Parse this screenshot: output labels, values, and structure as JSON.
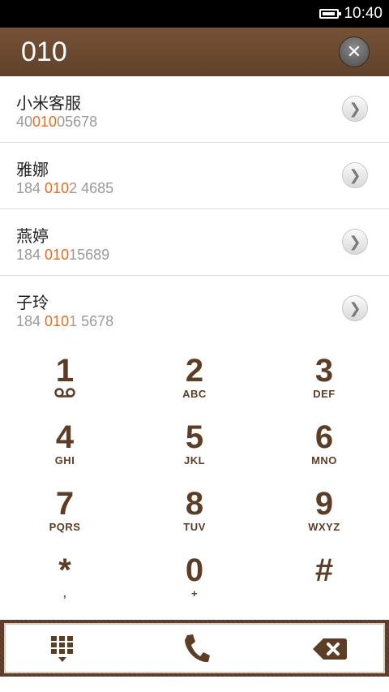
{
  "status_bar": {
    "time": "10:40",
    "battery_level": 0.9
  },
  "search": {
    "query": "010",
    "clear_icon": "close-icon"
  },
  "results": [
    {
      "name": "小米客服",
      "number_parts": [
        "40",
        "010",
        "05678"
      ]
    },
    {
      "name": "雅娜",
      "number_parts": [
        "184 ",
        "010",
        "2 4685"
      ]
    },
    {
      "name": "燕婷",
      "number_parts": [
        "184 ",
        "010",
        "15689"
      ]
    },
    {
      "name": "子玲",
      "number_parts": [
        "184 ",
        "010",
        "1 5678"
      ]
    }
  ],
  "keypad": [
    {
      "digit": "1",
      "letters": "",
      "sub_icon": "voicemail-icon"
    },
    {
      "digit": "2",
      "letters": "ABC"
    },
    {
      "digit": "3",
      "letters": "DEF"
    },
    {
      "digit": "4",
      "letters": "GHI"
    },
    {
      "digit": "5",
      "letters": "JKL"
    },
    {
      "digit": "6",
      "letters": "MNO"
    },
    {
      "digit": "7",
      "letters": "PQRS"
    },
    {
      "digit": "8",
      "letters": "TUV"
    },
    {
      "digit": "9",
      "letters": "WXYZ"
    },
    {
      "digit": "*",
      "letters": ","
    },
    {
      "digit": "0",
      "letters": "+"
    },
    {
      "digit": "#",
      "letters": ""
    }
  ],
  "actions": {
    "left_icon": "keypad-toggle-icon",
    "center_icon": "phone-call-icon",
    "right_icon": "backspace-icon"
  },
  "colors": {
    "accent_brown": "#5c3d25",
    "highlight_orange": "#e96b1c",
    "header_brown": "#6b4a2e"
  }
}
